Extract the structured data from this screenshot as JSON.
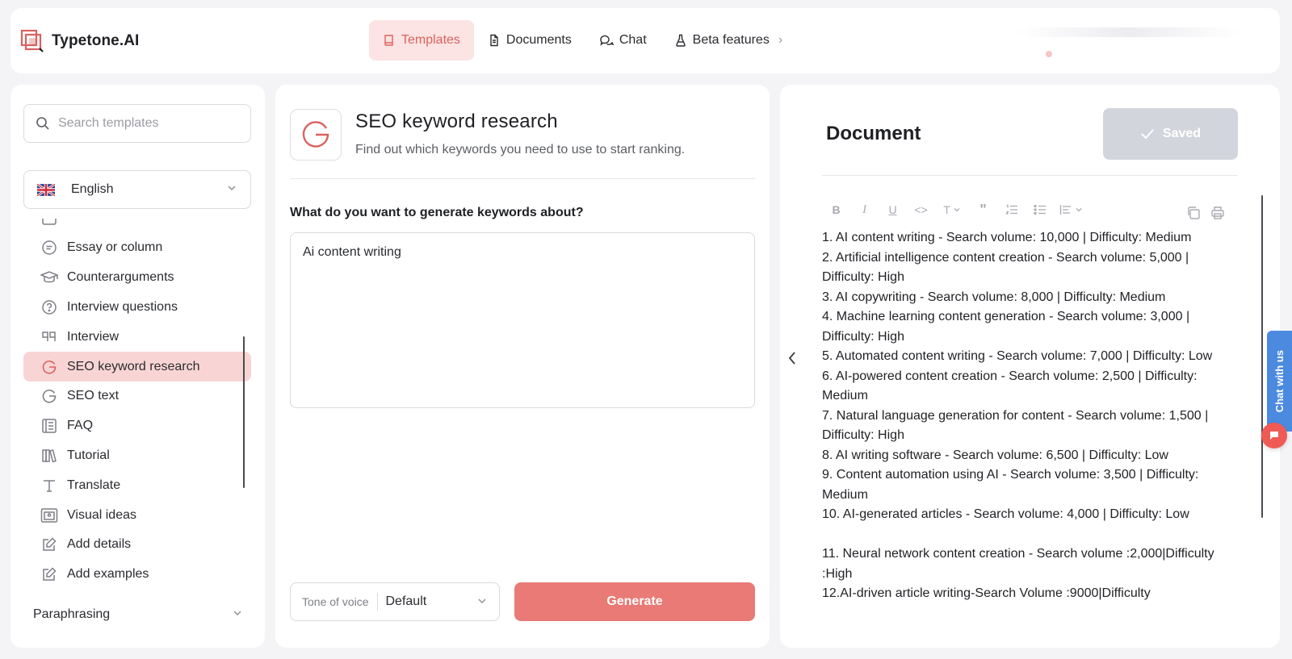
{
  "app": {
    "name": "Typetone.AI"
  },
  "nav": {
    "items": [
      {
        "label": "Templates",
        "icon": "book-icon",
        "active": true
      },
      {
        "label": "Documents",
        "icon": "document-icon",
        "active": false
      },
      {
        "label": "Chat",
        "icon": "chat-icon",
        "active": false
      },
      {
        "label": "Beta features",
        "icon": "flask-icon",
        "active": false
      }
    ]
  },
  "sidebar": {
    "search_placeholder": "Search templates",
    "language": "English",
    "items": [
      {
        "label": "Essay or column",
        "icon": "chat-lines-icon"
      },
      {
        "label": "Counterarguments",
        "icon": "graduation-cap-icon"
      },
      {
        "label": "Interview questions",
        "icon": "question-circle-icon"
      },
      {
        "label": "Interview",
        "icon": "quote-icon"
      },
      {
        "label": "SEO keyword research",
        "icon": "google-g-icon",
        "active": true
      },
      {
        "label": "SEO text",
        "icon": "google-g-icon"
      },
      {
        "label": "FAQ",
        "icon": "faq-list-icon"
      },
      {
        "label": "Tutorial",
        "icon": "books-icon"
      },
      {
        "label": "Translate",
        "icon": "text-t-icon"
      },
      {
        "label": "Visual ideas",
        "icon": "image-frame-icon"
      },
      {
        "label": "Add details",
        "icon": "edit-icon"
      },
      {
        "label": "Add examples",
        "icon": "edit-icon"
      }
    ],
    "section": "Paraphrasing"
  },
  "template": {
    "title": "SEO keyword research",
    "subtitle": "Find out which keywords you need to use to start ranking.",
    "question": "What do you want to generate keywords about?",
    "answer": "Ai content writing",
    "tone_label": "Tone of voice",
    "tone_value": "Default",
    "generate_label": "Generate"
  },
  "document": {
    "title": "Document",
    "saved_label": "Saved",
    "lines": [
      "1. AI content writing - Search volume: 10,000 | Difficulty: Medium",
      "2. Artificial intelligence content creation - Search volume: 5,000 | Difficulty: High",
      "3. AI copywriting - Search volume: 8,000 | Difficulty: Medium",
      "4. Machine learning content generation - Search volume: 3,000 | Difficulty: High",
      "5. Automated content writing - Search volume: 7,000 | Difficulty: Low",
      "6. AI-powered content creation - Search volume: 2,500 | Difficulty: Medium",
      "7. Natural language generation for content - Search volume: 1,500 | Difficulty: High",
      "8. AI writing software - Search volume: 6,500 | Difficulty: Low",
      "9. Content automation using AI - Search volume: 3,500 | Difficulty: Medium",
      "10. AI-generated articles - Search volume: 4,000 | Difficulty: Low",
      "",
      "11. Neural network content creation - Search volume :2,000|Difficulty :High",
      "12.AI-driven article writing-Search Volume :9000|Difficulty"
    ]
  },
  "chat_widget": {
    "label": "Chat with us"
  },
  "colors": {
    "accent": "#e97a76",
    "accent_light": "#fbe4e3",
    "chat_blue": "#4c8ae0"
  }
}
